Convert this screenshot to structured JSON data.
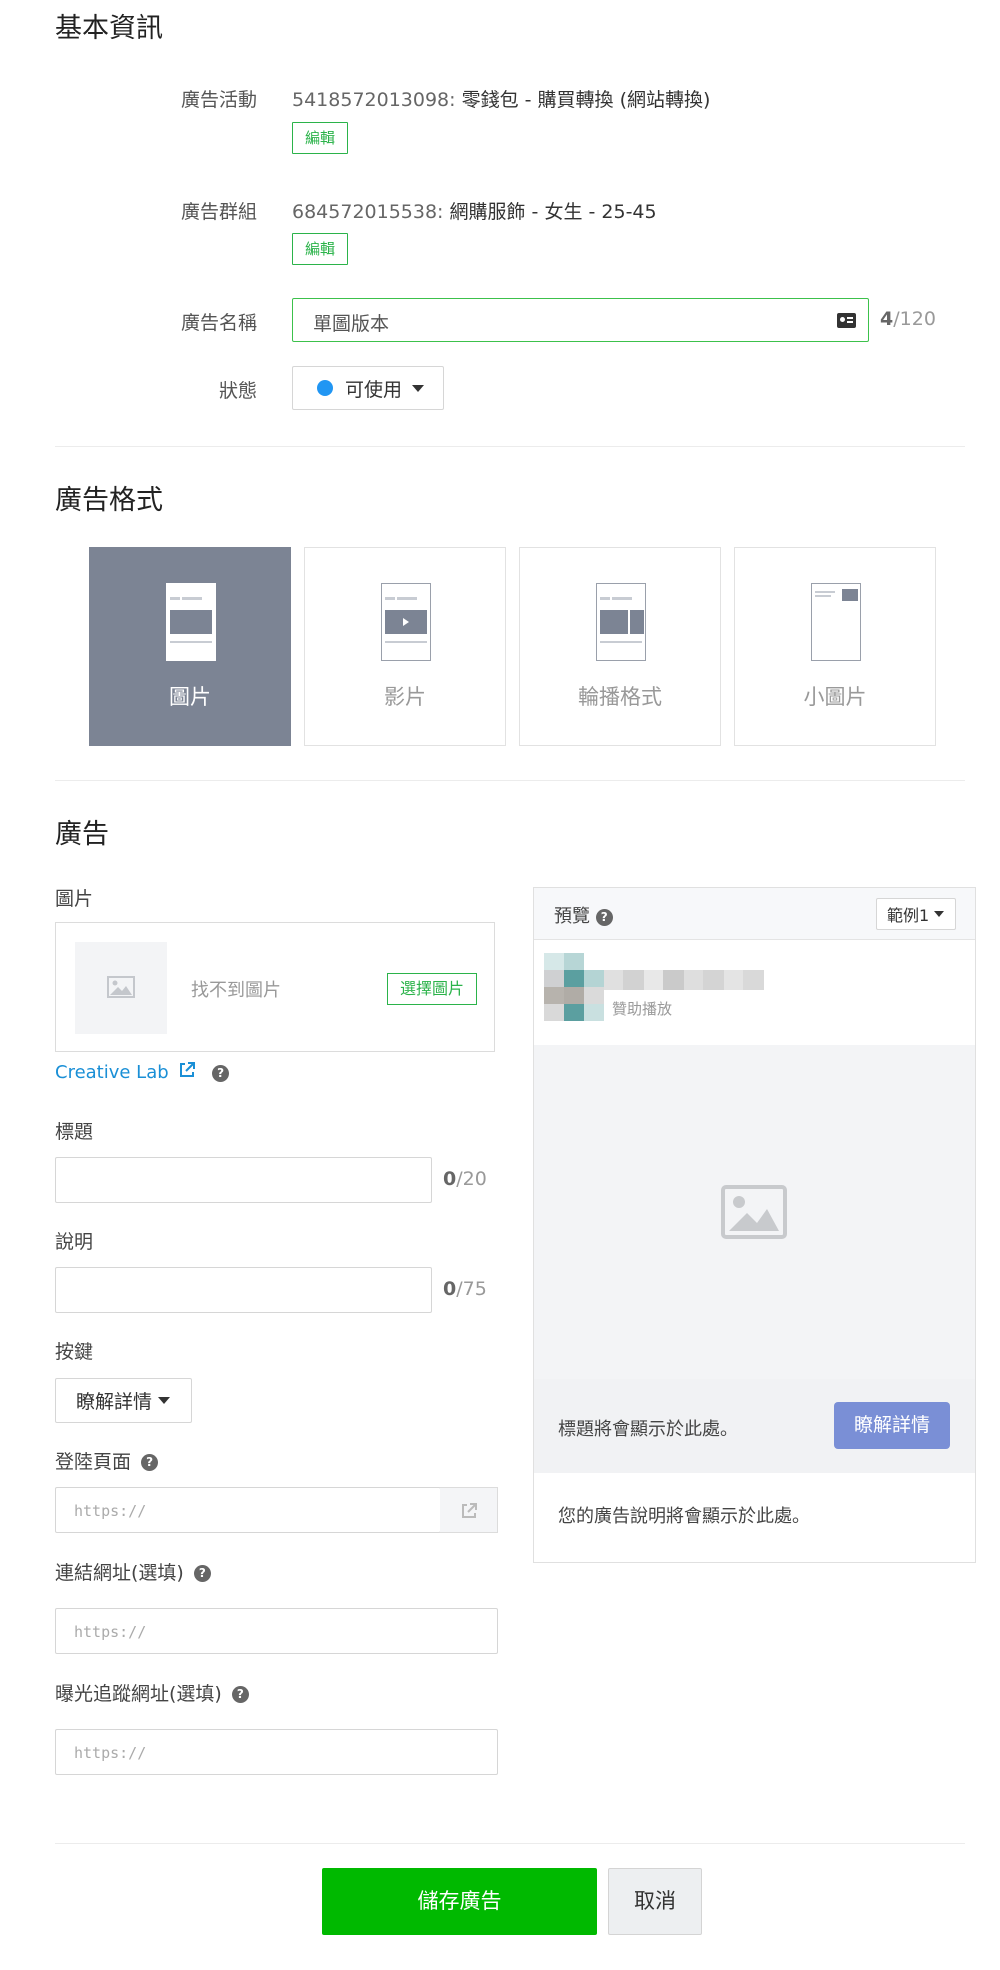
{
  "basic_info": {
    "title": "基本資訊",
    "campaign_label": "廣告活動",
    "campaign_id": "5418572013098:",
    "campaign_name": "零錢包 - 購買轉換 (網站轉換)",
    "group_label": "廣告群組",
    "group_id": "684572015538:",
    "group_name": "網購服飾 - 女生 - 25-45",
    "edit_label": "編輯",
    "name_label": "廣告名稱",
    "name_value": "單圖版本",
    "name_count": "4",
    "name_max": "/120",
    "status_label": "狀態",
    "status_value": "可使用",
    "status_color": "#2196f3"
  },
  "ad_format": {
    "title": "廣告格式",
    "options": [
      {
        "label": "圖片",
        "icon": "image-format-icon"
      },
      {
        "label": "影片",
        "icon": "video-format-icon"
      },
      {
        "label": "輪播格式",
        "icon": "carousel-format-icon"
      },
      {
        "label": "小圖片",
        "icon": "small-image-format-icon"
      }
    ],
    "selected": "圖片"
  },
  "ad": {
    "title": "廣告",
    "image_label": "圖片",
    "image_empty": "找不到圖片",
    "choose_image": "選擇圖片",
    "creative_lab": "Creative Lab",
    "headline_label": "標題",
    "headline_count": "0",
    "headline_max": "/20",
    "description_label": "說明",
    "description_count": "0",
    "description_max": "/75",
    "button_label": "按鍵",
    "button_value": "瞭解詳情",
    "landing_label": "登陸頁面",
    "landing_placeholder": "https://",
    "link_label": "連結網址(選填)",
    "link_placeholder": "https://",
    "tracking_label": "曝光追蹤網址(選填)",
    "tracking_placeholder": "https://"
  },
  "preview": {
    "title": "預覽",
    "example": "範例1",
    "sponsored": "贊助播放",
    "headline_placeholder": "標題將會顯示於此處。",
    "cta": "瞭解詳情",
    "description_placeholder": "您的廣告說明將會顯示於此處。"
  },
  "footer": {
    "save": "儲存廣告",
    "cancel": "取消"
  },
  "colors": {
    "brand_green": "#00b900",
    "edit_green": "#2bb34a",
    "link_blue": "#1a8fd6",
    "format_active": "#7c8494",
    "cta_blue": "#7a8fd6"
  }
}
